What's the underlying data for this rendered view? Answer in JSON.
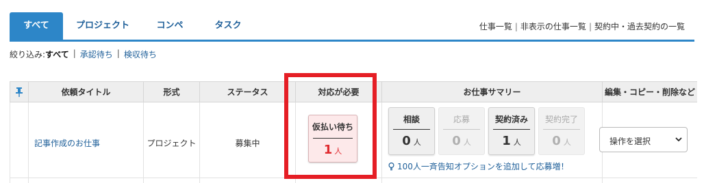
{
  "tabs": [
    {
      "label": "すべて",
      "active": true
    },
    {
      "label": "プロジェクト",
      "active": false
    },
    {
      "label": "コンペ",
      "active": false
    },
    {
      "label": "タスク",
      "active": false
    }
  ],
  "header_links": [
    "仕事一覧",
    "非表示の仕事一覧",
    "契約中・過去契約の一覧"
  ],
  "filter": {
    "label": "絞り込み:",
    "current": "すべて",
    "options": [
      "承認待ち",
      "検収待ち"
    ]
  },
  "table": {
    "headers": {
      "title": "依頼タイトル",
      "format": "形式",
      "status": "ステータス",
      "action": "対応が必要",
      "summary": "お仕事サマリー",
      "edit": "編集・コピー・削除など"
    },
    "row": {
      "title": "記事作成のお仕事",
      "format": "プロジェクト",
      "status": "募集中",
      "action": {
        "label": "仮払い待ち",
        "count": "1",
        "unit": "人"
      },
      "summary": [
        {
          "label": "相談",
          "count": "0",
          "unit": "人",
          "active": true
        },
        {
          "label": "応募",
          "count": "0",
          "unit": "人",
          "active": false
        },
        {
          "label": "契約済み",
          "count": "1",
          "unit": "人",
          "active": true
        },
        {
          "label": "契約完了",
          "count": "0",
          "unit": "人",
          "active": false
        }
      ],
      "notice": "100人一斉告知オプションを追加して応募増！",
      "operation_select": "操作を選択"
    }
  },
  "colors": {
    "accent": "#2d86c8",
    "link": "#1e5f99",
    "highlight": "#e51e25",
    "count_red": "#e02a2f"
  }
}
